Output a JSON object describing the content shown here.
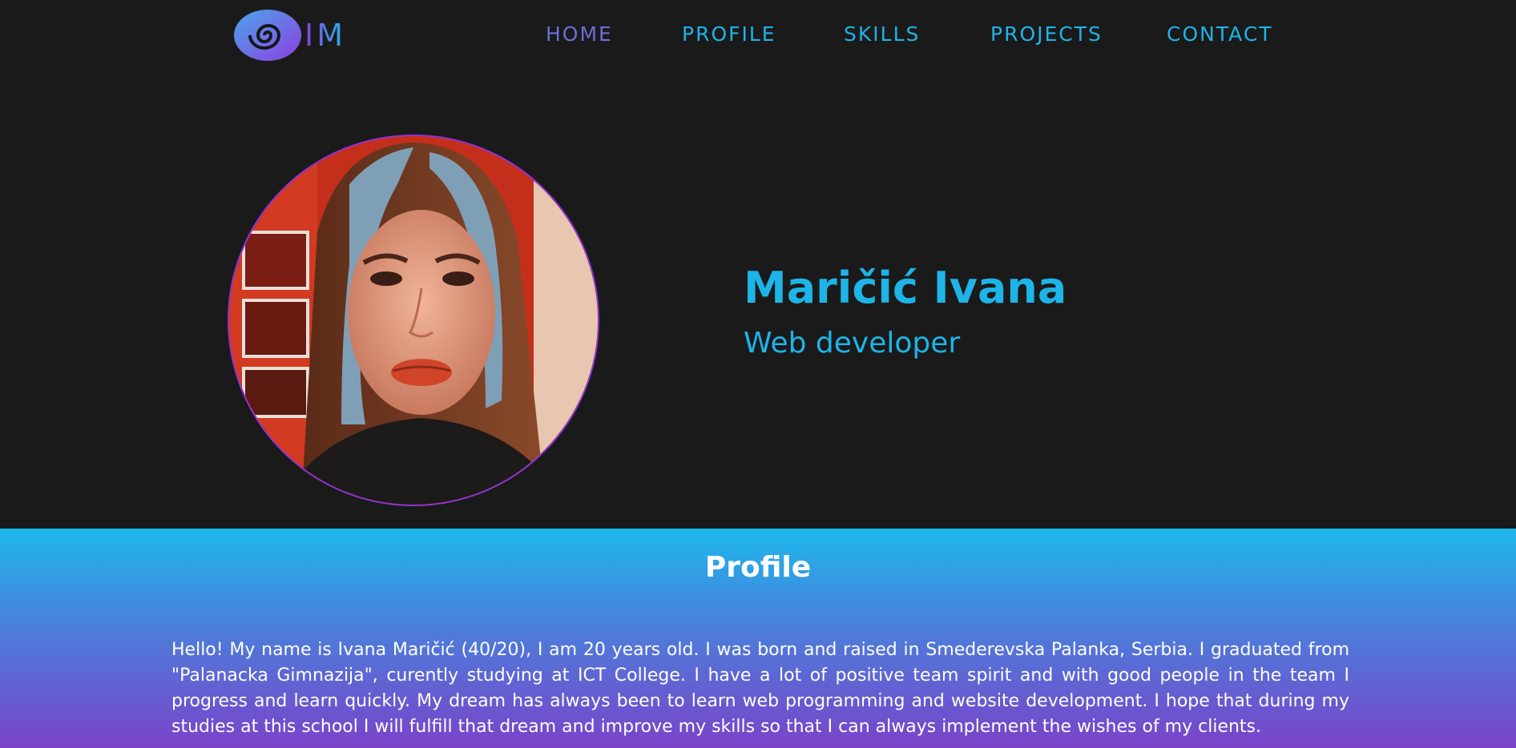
{
  "logo": {
    "text": "IM",
    "icon": "spiral-logo-icon"
  },
  "nav": {
    "items": [
      {
        "label": "HOME",
        "active": true
      },
      {
        "label": "PROFILE"
      },
      {
        "label": "SKILLS"
      },
      {
        "label": "PROJECTS"
      },
      {
        "label": "CONTACT"
      }
    ]
  },
  "hero": {
    "name": "Maričić Ivana",
    "role": "Web developer",
    "photo_alt": "Portrait photo"
  },
  "profile": {
    "title": "Profile",
    "text": "Hello! My name is Ivana Maričić (40/20), I am 20 years old. I was born and raised in Smederevska Palanka, Serbia. I graduated from \"Palanacka Gimnazija\", curently studying at ICT College. I have a lot of positive team spirit and with good people in the team I progress and learn quickly. My dream has always been to learn web programming and website development. I hope that during my studies at this school I will fulfill that dream and improve my skills so that I can always implement the wishes of my clients."
  },
  "colors": {
    "background": "#1a1a1a",
    "accent": "#1db4e7",
    "active_nav": "#6b6fd6",
    "purple": "#9033d6"
  }
}
